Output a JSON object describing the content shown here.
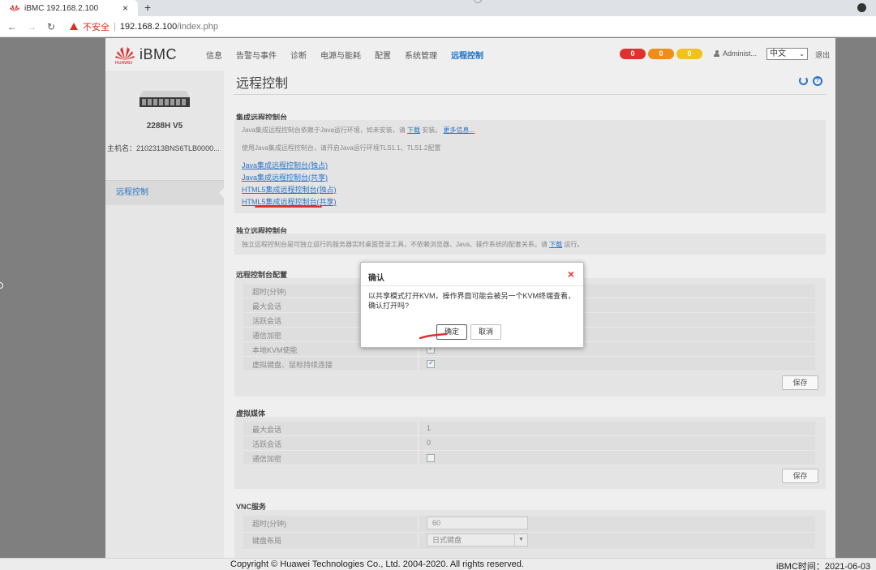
{
  "browser": {
    "tab_title": "iBMC 192.168.2.100",
    "tab_close": "×",
    "new_tab": "+",
    "security_label": "不安全",
    "separator": "|",
    "url_host": "192.168.2.100",
    "url_path": "/index.php"
  },
  "header": {
    "product": "iBMC",
    "brand_small": "HUAWEI",
    "menu": [
      {
        "label": "信息"
      },
      {
        "label": "告警与事件"
      },
      {
        "label": "诊断"
      },
      {
        "label": "电源与能耗"
      },
      {
        "label": "配置"
      },
      {
        "label": "系统管理"
      },
      {
        "label": "远程控制"
      }
    ],
    "active_menu": "远程控制",
    "alarms": [
      {
        "count": "0",
        "color": "#e0312e"
      },
      {
        "count": "0",
        "color": "#f08c1a"
      },
      {
        "count": "0",
        "color": "#f2c21b"
      }
    ],
    "user": "Administ...",
    "language": "中文",
    "logout": "退出"
  },
  "sidebar": {
    "model": "2288H V5",
    "host": "主机名：2102313BNS6TLB0000...",
    "items": [
      {
        "label": "远程控制"
      }
    ]
  },
  "main": {
    "title": "远程控制",
    "integrated": {
      "title": "集成远程控制台",
      "desc_prefix": "Java集成远程控制台依赖于Java运行环境，如未安装，请",
      "download": "下载",
      "desc_mid": "安装。",
      "more_info": "更多信息...",
      "tls_note": "使用Java集成远程控制台，请开启Java运行环境TLS1.1、TLS1.2配置",
      "links": [
        "Java集成远程控制台(独占)",
        "Java集成远程控制台(共享)",
        "HTML5集成远程控制台(独占)",
        "HTML5集成远程控制台(共享)"
      ]
    },
    "standalone": {
      "title": "独立远程控制台",
      "desc": "独立远程控制台是可独立运行的服务器实时桌面登录工具，不依赖浏览器、Java、操作系统的配套关系。请",
      "download": "下载",
      "desc_suffix": "运行。"
    },
    "console_config": {
      "title": "远程控制台配置",
      "rows": [
        {
          "label": "超时(分钟)"
        },
        {
          "label": "最大会话"
        },
        {
          "label": "活跃会话"
        },
        {
          "label": "通信加密"
        },
        {
          "label": "本地KVM使能",
          "checked": true
        },
        {
          "label": "虚拟键盘、鼠标持续连接",
          "checked": true
        }
      ],
      "save": "保存"
    },
    "virtual_media": {
      "title": "虚拟媒体",
      "rows": [
        {
          "label": "最大会话",
          "value": "1"
        },
        {
          "label": "活跃会话",
          "value": "0"
        },
        {
          "label": "通信加密",
          "checked": false
        }
      ],
      "save": "保存"
    },
    "vnc": {
      "title": "VNC服务",
      "rows": [
        {
          "label": "超时(分钟)",
          "value": "60"
        },
        {
          "label": "键盘布局",
          "value": "日式键盘"
        }
      ]
    }
  },
  "dialog": {
    "title": "确认",
    "close": "×",
    "message": "以共享模式打开KVM，操作界面可能会被另一个KVM终端查看，确认打开吗?",
    "ok": "确定",
    "cancel": "取消"
  },
  "footer": {
    "copyright": "Copyright © Huawei Technologies Co., Ltd. 2004-2020. All rights reserved.",
    "time_label": "iBMC时间：",
    "time_value": "2021-06-03"
  }
}
